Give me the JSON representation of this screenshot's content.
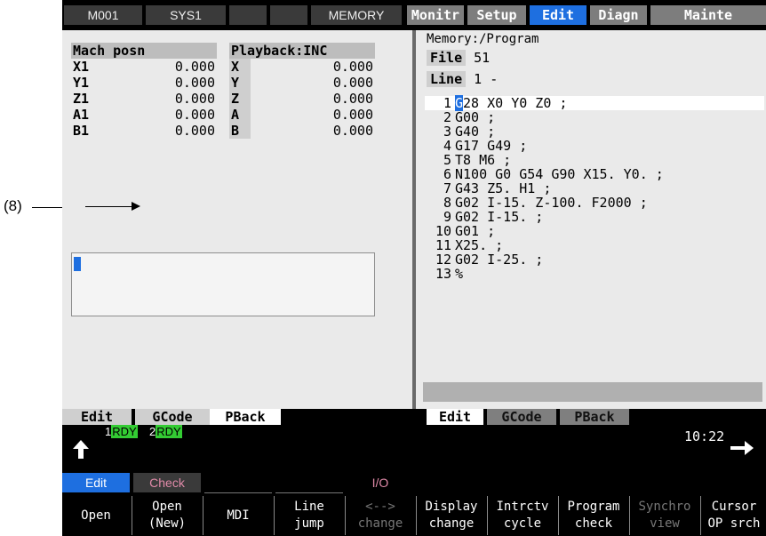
{
  "callout": {
    "label": "(8)"
  },
  "topbar": {
    "cells": [
      "M001",
      "SYS1",
      "",
      "",
      "MEMORY"
    ],
    "tabs": [
      {
        "label": "Monitr",
        "active": false
      },
      {
        "label": "Setup",
        "active": false
      },
      {
        "label": "Edit",
        "active": true
      },
      {
        "label": "Diagn",
        "active": false
      },
      {
        "label": "Mainte",
        "active": false
      }
    ]
  },
  "left": {
    "mach": {
      "title": "Mach posn",
      "rows": [
        {
          "axis": "X1",
          "value": "0.000"
        },
        {
          "axis": "Y1",
          "value": "0.000"
        },
        {
          "axis": "Z1",
          "value": "0.000"
        },
        {
          "axis": "A1",
          "value": "0.000"
        },
        {
          "axis": "B1",
          "value": "0.000"
        }
      ]
    },
    "playback": {
      "title": "Playback:INC",
      "rows": [
        {
          "axis": "X",
          "value": "0.000"
        },
        {
          "axis": "Y",
          "value": "0.000"
        },
        {
          "axis": "Z",
          "value": "0.000"
        },
        {
          "axis": "A",
          "value": "0.000"
        },
        {
          "axis": "B",
          "value": "0.000"
        }
      ]
    }
  },
  "right": {
    "path": "Memory:/Program",
    "file_label": "File",
    "file_value": "51",
    "line_label": "Line",
    "line_value": "1 -",
    "code": [
      {
        "n": "1",
        "text": "G28 X0 Y0 Z0 ;"
      },
      {
        "n": "2",
        "text": "G00 ;"
      },
      {
        "n": "3",
        "text": "G40 ;"
      },
      {
        "n": "4",
        "text": "G17 G49 ;"
      },
      {
        "n": "5",
        "text": "T8 M6 ;"
      },
      {
        "n": "6",
        "text": "N100 G0 G54 G90 X15. Y0. ;"
      },
      {
        "n": "7",
        "text": "G43 Z5. H1 ;"
      },
      {
        "n": "8",
        "text": "G02 I-15. Z-100. F2000 ;"
      },
      {
        "n": "9",
        "text": "G02 I-15. ;"
      },
      {
        "n": "10",
        "text": "G01 ;"
      },
      {
        "n": "11",
        "text": "X25. ;"
      },
      {
        "n": "12",
        "text": "G02 I-25. ;"
      },
      {
        "n": "13",
        "text": "%"
      }
    ]
  },
  "left_tabs": [
    {
      "label": "Edit",
      "state": "normal"
    },
    {
      "label": "GCode",
      "state": "normal"
    },
    {
      "label": "PBack",
      "state": "active"
    }
  ],
  "right_tabs": [
    {
      "label": "Edit",
      "state": "active"
    },
    {
      "label": "GCode",
      "state": "dim"
    },
    {
      "label": "PBack",
      "state": "dim"
    }
  ],
  "status": {
    "rdy1_num": "1",
    "rdy1_tag": "RDY",
    "rdy2_num": "2",
    "rdy2_tag": "RDY",
    "time": "10:22"
  },
  "softkeys": [
    {
      "top": "Edit",
      "bottom": "Open"
    },
    {
      "top": "Check",
      "bottom": "Open\n(New)"
    },
    {
      "top": "",
      "bottom": "MDI"
    },
    {
      "top": "",
      "bottom": "Line\njump"
    },
    {
      "top": "I/O",
      "bottom": "<-->\nchange"
    },
    {
      "top": "",
      "bottom": "Display\nchange"
    },
    {
      "top": "",
      "bottom": "Intrctv\ncycle"
    },
    {
      "top": "",
      "bottom": "Program\ncheck"
    },
    {
      "top": "",
      "bottom": "Synchro\nview"
    },
    {
      "top": "",
      "bottom": "Cursor\nOP srch"
    }
  ],
  "colors": {
    "accent": "#1e6fe0",
    "ready": "#33cc33",
    "pane": "#eaeaea"
  }
}
